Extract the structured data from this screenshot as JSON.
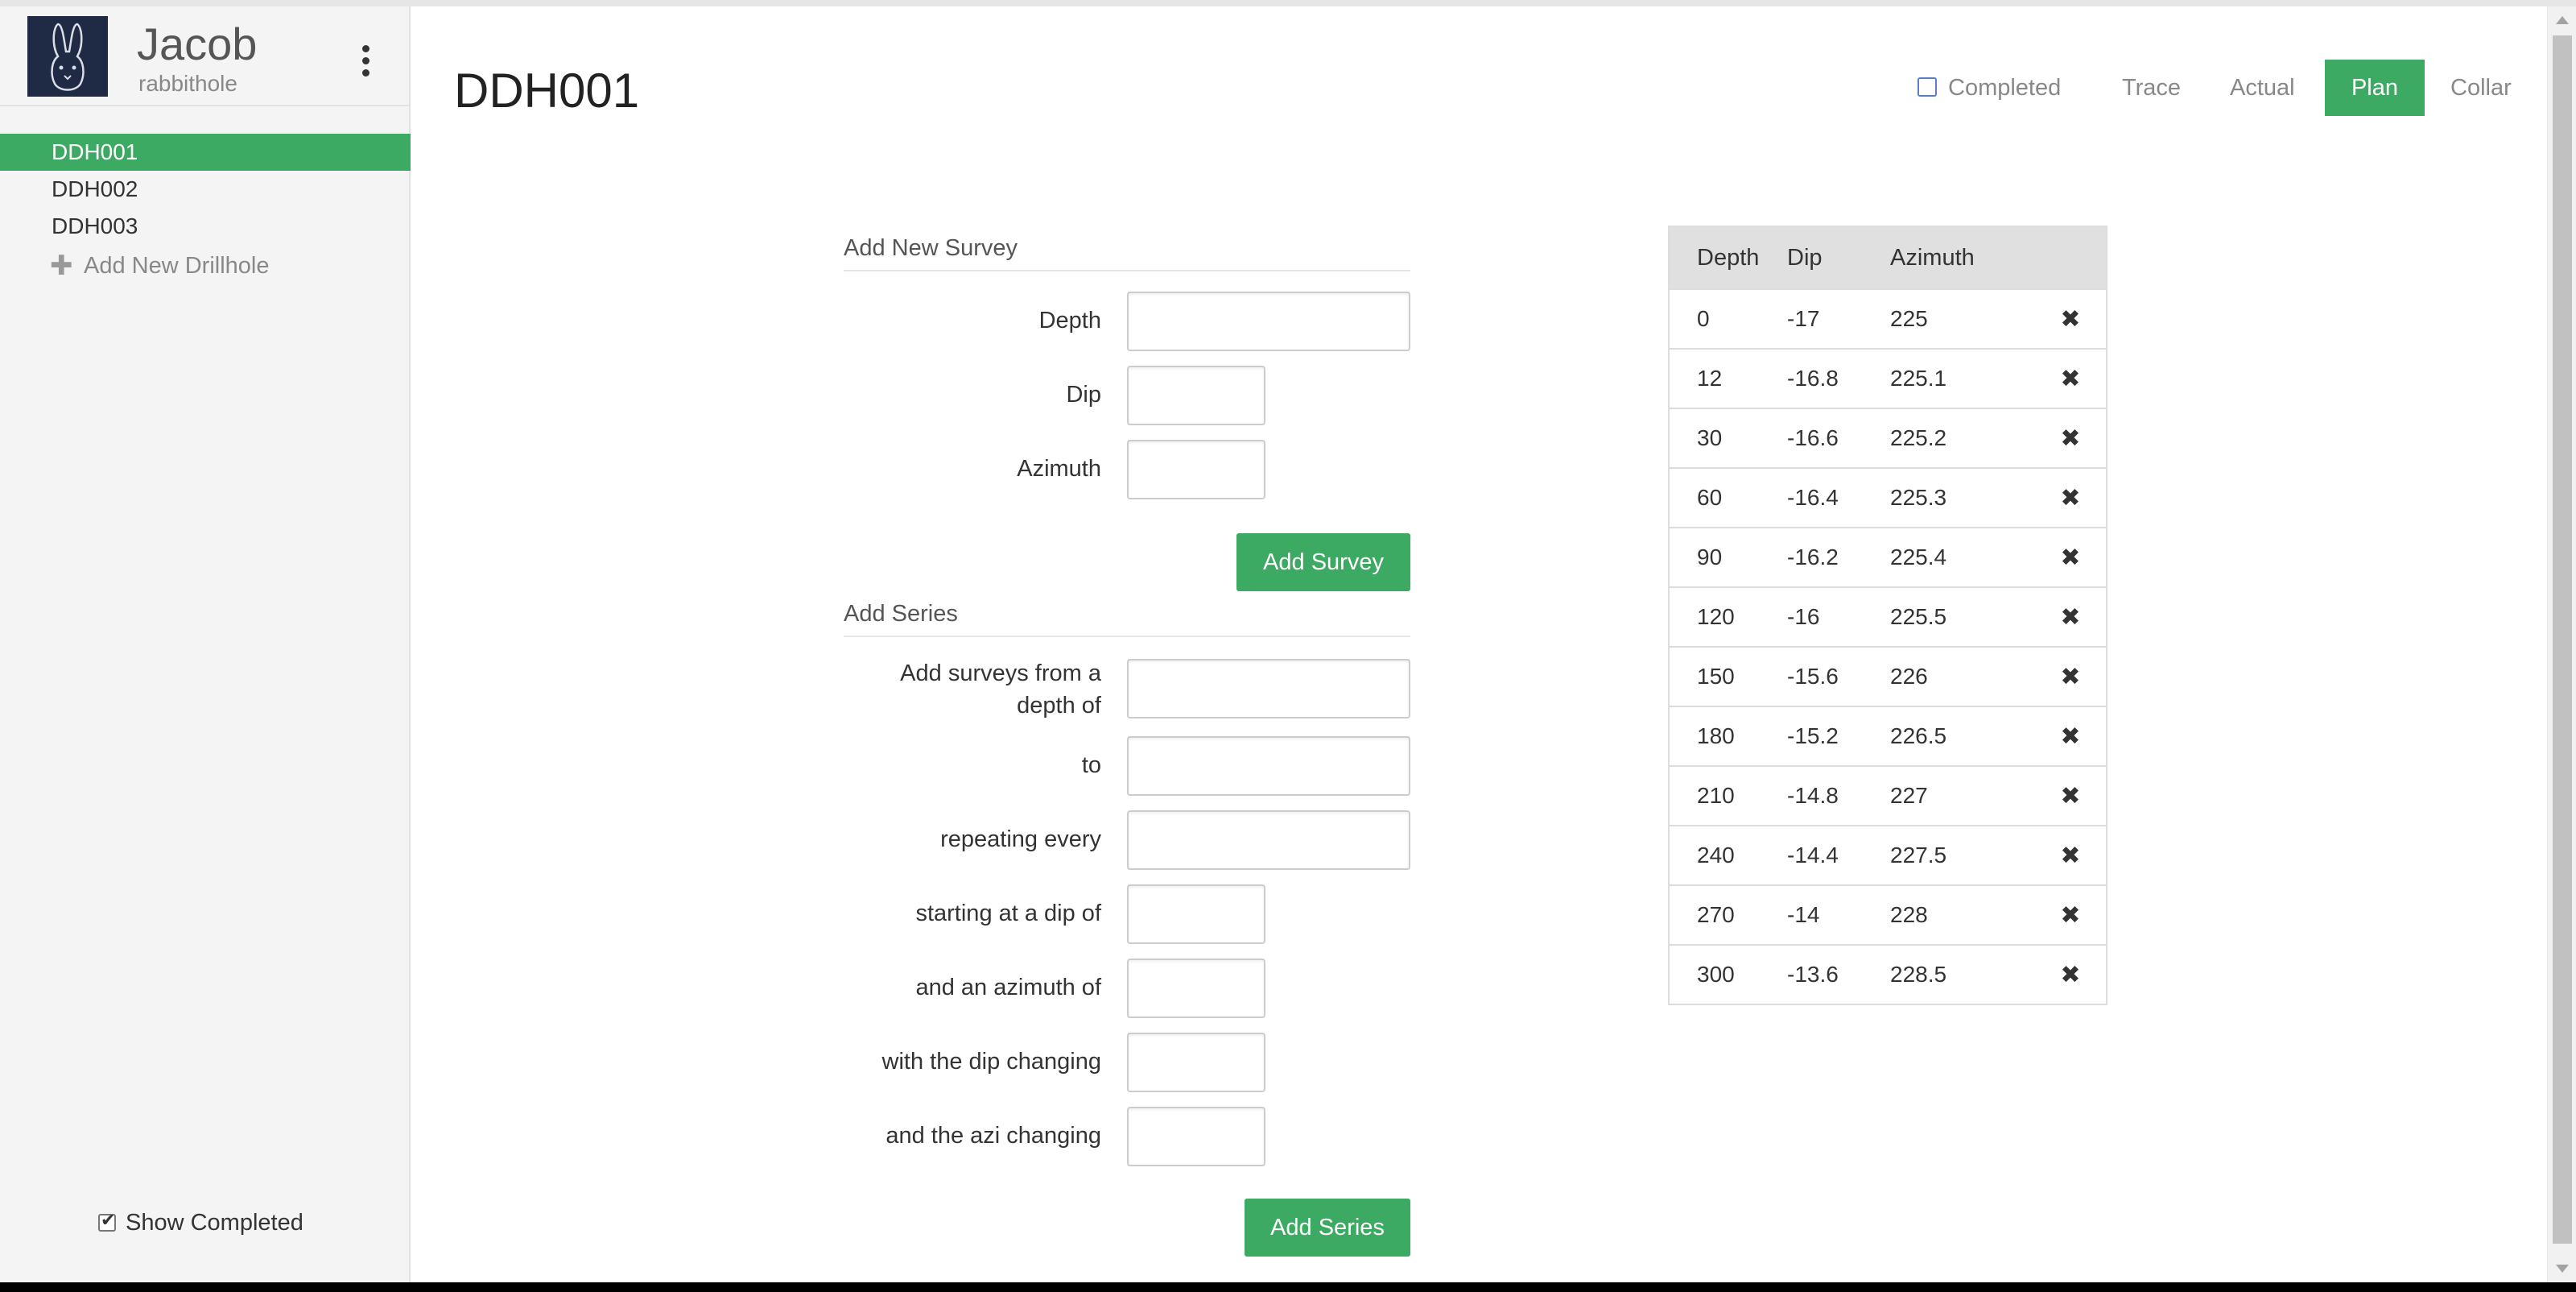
{
  "user": {
    "name": "Jacob",
    "subtitle": "rabbithole"
  },
  "sidebar": {
    "drillholes": [
      "DDH001",
      "DDH002",
      "DDH003"
    ],
    "active": "DDH001",
    "add_label": "Add New Drillhole",
    "show_completed_label": "Show Completed",
    "show_completed_checked": true
  },
  "page": {
    "title": "DDH001"
  },
  "nav": {
    "completed_label": "Completed",
    "completed_checked": false,
    "tabs": [
      "Trace",
      "Actual",
      "Plan",
      "Collar"
    ],
    "active_tab": "Plan"
  },
  "add_survey": {
    "heading": "Add New Survey",
    "depth_label": "Depth",
    "dip_label": "Dip",
    "azimuth_label": "Azimuth",
    "button": "Add Survey"
  },
  "add_series": {
    "heading": "Add Series",
    "from_label_line1": "Add surveys from a",
    "from_label_line2": "depth of",
    "to_label": "to",
    "repeat_label": "repeating every",
    "dip_label": "starting at a dip of",
    "azi_label": "and an azimuth of",
    "dip_change_label": "with the dip changing",
    "azi_change_label": "and the azi changing",
    "button": "Add Series"
  },
  "table": {
    "headers": [
      "Depth",
      "Dip",
      "Azimuth"
    ],
    "rows": [
      [
        "0",
        "-17",
        "225"
      ],
      [
        "12",
        "-16.8",
        "225.1"
      ],
      [
        "30",
        "-16.6",
        "225.2"
      ],
      [
        "60",
        "-16.4",
        "225.3"
      ],
      [
        "90",
        "-16.2",
        "225.4"
      ],
      [
        "120",
        "-16",
        "225.5"
      ],
      [
        "150",
        "-15.6",
        "226"
      ],
      [
        "180",
        "-15.2",
        "226.5"
      ],
      [
        "210",
        "-14.8",
        "227"
      ],
      [
        "240",
        "-14.4",
        "227.5"
      ],
      [
        "270",
        "-14",
        "228"
      ],
      [
        "300",
        "-13.6",
        "228.5"
      ]
    ],
    "delete_icon": "✖"
  },
  "colors": {
    "accent": "#3daa63",
    "sidebar_bg": "#f4f4f4",
    "avatar_bg": "#1f2a44"
  }
}
